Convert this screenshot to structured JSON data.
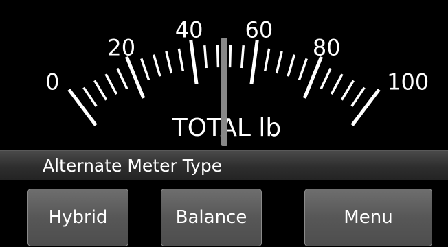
{
  "meter": {
    "scale_labels": [
      "0",
      "20",
      "40",
      "60",
      "80",
      "100"
    ],
    "unit_label": "TOTAL lb",
    "needle_value": 50,
    "scale_min": 0,
    "scale_max": 100,
    "colors": {
      "background": "#000000",
      "ticks": "#ffffff",
      "needle": "#888888"
    }
  },
  "status": {
    "label": "Alternate Meter Type"
  },
  "buttons": {
    "hybrid": "Hybrid",
    "balance": "Balance",
    "menu": "Menu"
  }
}
